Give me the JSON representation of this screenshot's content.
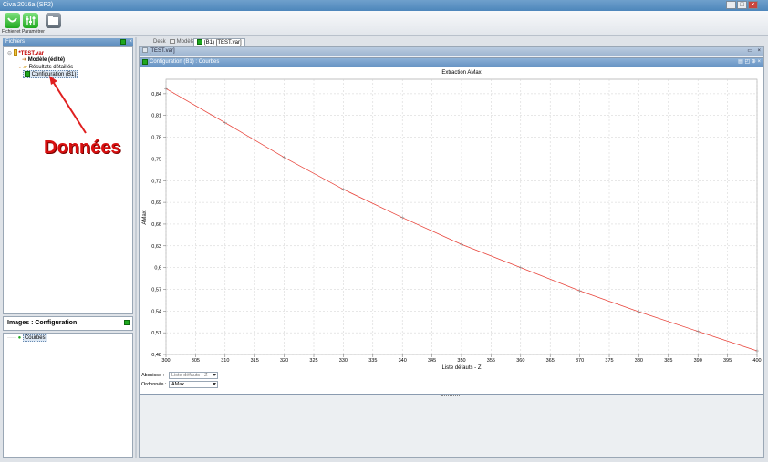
{
  "window": {
    "title": "Civa 2016a (SP2)"
  },
  "toolbar": {
    "label": "Fichier et Paramètrer"
  },
  "left": {
    "files_title": "Fichiers",
    "tree": [
      {
        "label": "*TEST.var"
      },
      {
        "label": "Modèle (édité)"
      },
      {
        "label": "Résultats détaillés"
      },
      {
        "label": "Configuration (B1)"
      }
    ],
    "annotation": "Données",
    "images_title": "Images : Configuration",
    "images_tree": [
      {
        "label": "Courbes"
      }
    ]
  },
  "tabs": [
    {
      "label": "Desk"
    },
    {
      "label": "Modèle"
    },
    {
      "label": "(B1) [TEST.var]"
    }
  ],
  "outer_window": {
    "title": "[TEST.var]"
  },
  "inner_window": {
    "title": "Configuration (B1) : Courbes"
  },
  "controls": {
    "abscisse_label": "Abscisse :",
    "abscisse_value": "Liste défauts - Z",
    "ordonnee_label": "Ordonnée :",
    "ordonnee_value": "AMax"
  },
  "colors": {
    "curve": "#e8453c",
    "accent": "#1fa81f"
  },
  "chart_data": {
    "type": "line",
    "title": "Extraction AMax",
    "xlabel": "Liste défauts - Z",
    "ylabel": "AMax",
    "xlim": [
      300,
      400
    ],
    "ylim": [
      0.48,
      0.86
    ],
    "xticks": [
      300,
      305,
      310,
      315,
      320,
      325,
      330,
      335,
      340,
      345,
      350,
      355,
      360,
      365,
      370,
      375,
      380,
      385,
      390,
      395,
      400
    ],
    "yticks": [
      "0,48",
      "0,51",
      "0,54",
      "0,57",
      "0,6",
      "0,63",
      "0,66",
      "0,69",
      "0,72",
      "0,75",
      "0,78",
      "0,81",
      "0,84"
    ],
    "grid": true,
    "series": [
      {
        "x": [
          300,
          310,
          320,
          330,
          340,
          350,
          360,
          370,
          380,
          390,
          400
        ],
        "y": [
          0.847,
          0.8,
          0.752,
          0.708,
          0.669,
          0.632,
          0.6,
          0.568,
          0.539,
          0.512,
          0.485
        ]
      }
    ]
  }
}
